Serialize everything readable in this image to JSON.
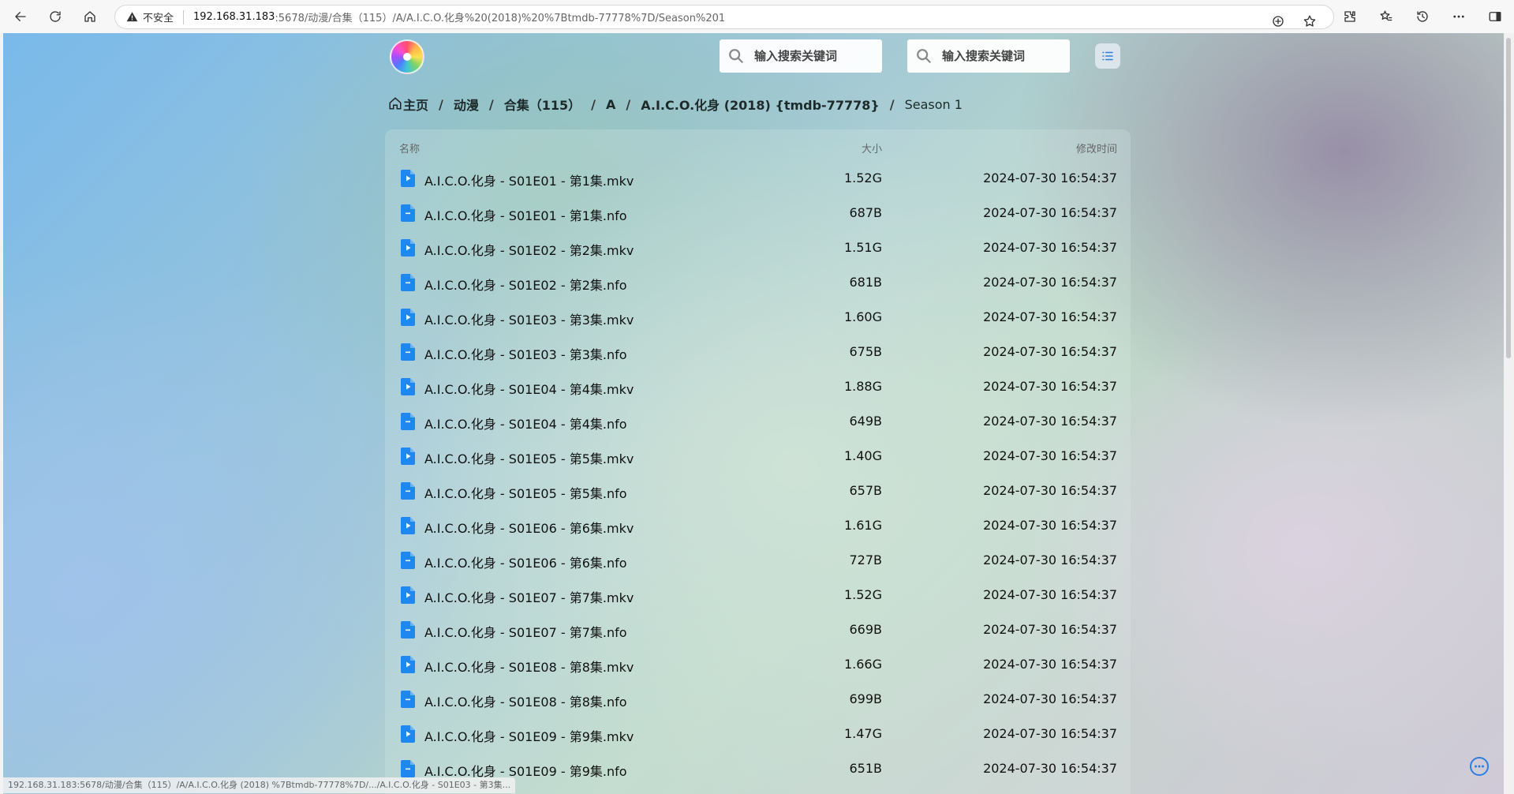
{
  "browser": {
    "security_label": "不安全",
    "url_host": "192.168.31.183",
    "url_path": ":5678/动漫/合集（115）/A/A.I.C.O.化身%20(2018)%20%7Btmdb-77778%7D/Season%201"
  },
  "header": {
    "search_placeholder_1": "输入搜索关键词",
    "search_placeholder_2": "输入搜索关键词"
  },
  "breadcrumb": {
    "home": "主页",
    "items": [
      "动漫",
      "合集（115）",
      "A",
      "A.I.C.O.化身 (2018) {tmdb-77778}",
      "Season 1"
    ]
  },
  "table": {
    "col_name": "名称",
    "col_size": "大小",
    "col_time": "修改时间",
    "rows": [
      {
        "name": "A.I.C.O.化身 - S01E01 - 第1集.mkv",
        "size": "1.52G",
        "time": "2024-07-30 16:54:37",
        "type": "video"
      },
      {
        "name": "A.I.C.O.化身 - S01E01 - 第1集.nfo",
        "size": "687B",
        "time": "2024-07-30 16:54:37",
        "type": "text"
      },
      {
        "name": "A.I.C.O.化身 - S01E02 - 第2集.mkv",
        "size": "1.51G",
        "time": "2024-07-30 16:54:37",
        "type": "video"
      },
      {
        "name": "A.I.C.O.化身 - S01E02 - 第2集.nfo",
        "size": "681B",
        "time": "2024-07-30 16:54:37",
        "type": "text"
      },
      {
        "name": "A.I.C.O.化身 - S01E03 - 第3集.mkv",
        "size": "1.60G",
        "time": "2024-07-30 16:54:37",
        "type": "video"
      },
      {
        "name": "A.I.C.O.化身 - S01E03 - 第3集.nfo",
        "size": "675B",
        "time": "2024-07-30 16:54:37",
        "type": "text"
      },
      {
        "name": "A.I.C.O.化身 - S01E04 - 第4集.mkv",
        "size": "1.88G",
        "time": "2024-07-30 16:54:37",
        "type": "video"
      },
      {
        "name": "A.I.C.O.化身 - S01E04 - 第4集.nfo",
        "size": "649B",
        "time": "2024-07-30 16:54:37",
        "type": "text"
      },
      {
        "name": "A.I.C.O.化身 - S01E05 - 第5集.mkv",
        "size": "1.40G",
        "time": "2024-07-30 16:54:37",
        "type": "video"
      },
      {
        "name": "A.I.C.O.化身 - S01E05 - 第5集.nfo",
        "size": "657B",
        "time": "2024-07-30 16:54:37",
        "type": "text"
      },
      {
        "name": "A.I.C.O.化身 - S01E06 - 第6集.mkv",
        "size": "1.61G",
        "time": "2024-07-30 16:54:37",
        "type": "video"
      },
      {
        "name": "A.I.C.O.化身 - S01E06 - 第6集.nfo",
        "size": "727B",
        "time": "2024-07-30 16:54:37",
        "type": "text"
      },
      {
        "name": "A.I.C.O.化身 - S01E07 - 第7集.mkv",
        "size": "1.52G",
        "time": "2024-07-30 16:54:37",
        "type": "video"
      },
      {
        "name": "A.I.C.O.化身 - S01E07 - 第7集.nfo",
        "size": "669B",
        "time": "2024-07-30 16:54:37",
        "type": "text"
      },
      {
        "name": "A.I.C.O.化身 - S01E08 - 第8集.mkv",
        "size": "1.66G",
        "time": "2024-07-30 16:54:37",
        "type": "video"
      },
      {
        "name": "A.I.C.O.化身 - S01E08 - 第8集.nfo",
        "size": "699B",
        "time": "2024-07-30 16:54:37",
        "type": "text"
      },
      {
        "name": "A.I.C.O.化身 - S01E09 - 第9集.mkv",
        "size": "1.47G",
        "time": "2024-07-30 16:54:37",
        "type": "video"
      },
      {
        "name": "A.I.C.O.化身 - S01E09 - 第9集.nfo",
        "size": "651B",
        "time": "2024-07-30 16:54:37",
        "type": "text"
      }
    ]
  },
  "statusbar": {
    "text": "192.168.31.183:5678/动漫/合集（115）/A/A.I.C.O.化身 (2018) %7Btmdb-77778%7D/.../A.I.C.O.化身 - S01E03 - 第3集..."
  },
  "colors": {
    "file_icon": "#1e88f0",
    "accent": "#2d7ee0"
  }
}
